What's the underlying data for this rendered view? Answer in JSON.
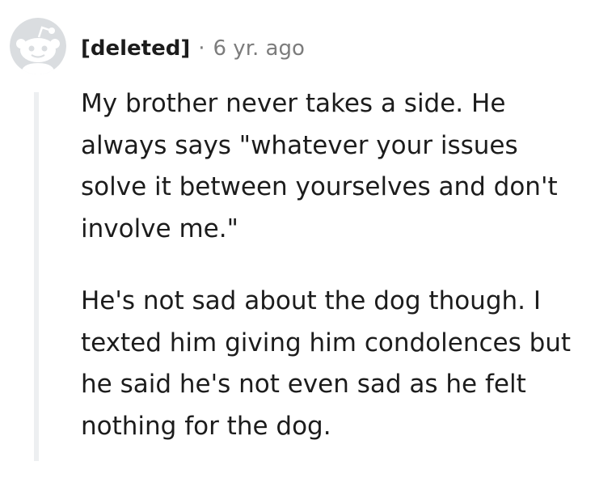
{
  "comment": {
    "author": "[deleted]",
    "separator": "·",
    "timestamp": "6 yr. ago",
    "avatar_icon": "snoo-avatar-icon",
    "paragraphs": [
      "My brother never takes a side. He always says \"whatever your issues solve it between yourselves and don't involve me.\"",
      "He's not sad about the dog though. I texted him giving him condolences but he said he's not even sad as he felt nothing for the dog."
    ]
  },
  "colors": {
    "text": "#1c1c1c",
    "meta": "#7c7c7c",
    "thread_line": "#edeff1",
    "avatar_bg": "#dadde0",
    "avatar_fg": "#ffffff"
  }
}
